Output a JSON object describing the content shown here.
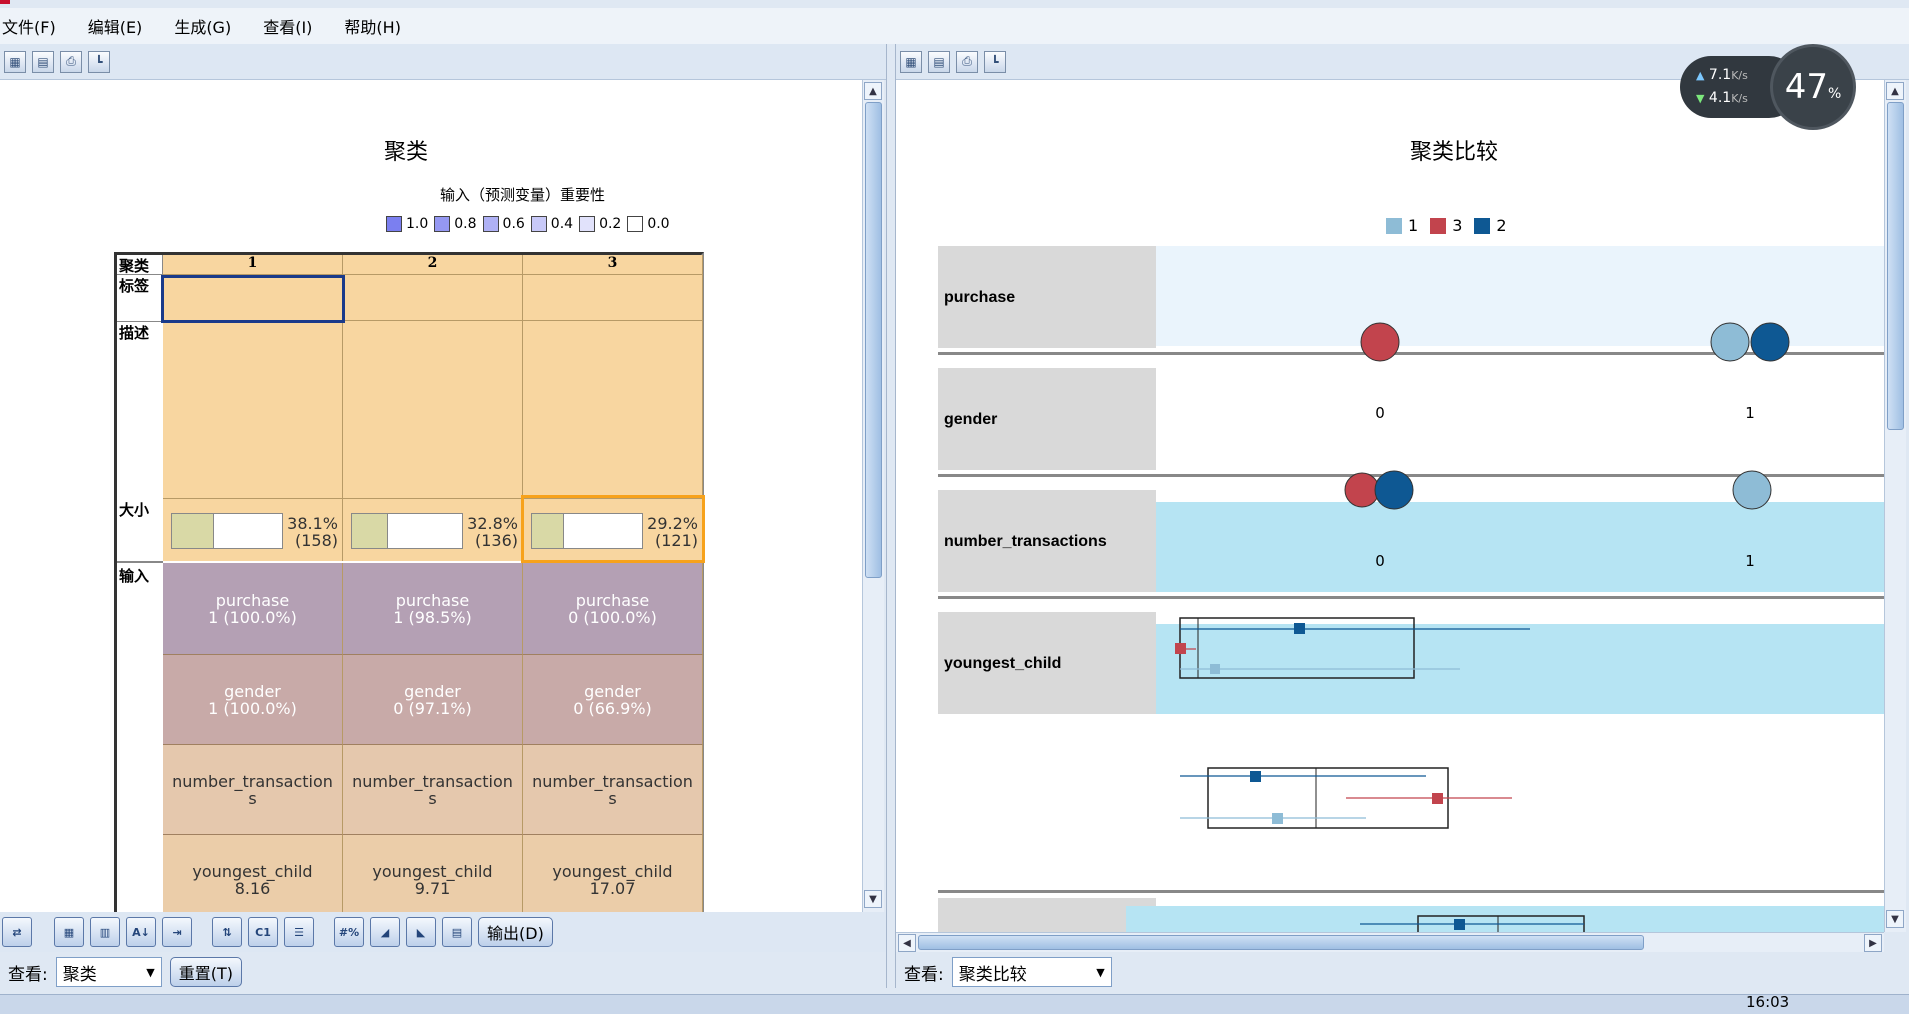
{
  "menu": [
    "文件(F)",
    "编辑(E)",
    "生成(G)",
    "查看(I)",
    "帮助(H)"
  ],
  "left": {
    "title": "聚类",
    "legend_title": "输入（预测变量）重要性",
    "legend": [
      {
        "label": "1.0",
        "color": "#7b7ff0"
      },
      {
        "label": "0.8",
        "color": "#9598f2"
      },
      {
        "label": "0.6",
        "color": "#afb1f5"
      },
      {
        "label": "0.4",
        "color": "#c8c9f8"
      },
      {
        "label": "0.2",
        "color": "#e1e2fb"
      },
      {
        "label": "0.0",
        "color": "#ffffff"
      }
    ],
    "row_labels": {
      "cluster": "聚类",
      "tag": "标签",
      "desc": "描述",
      "size": "大小",
      "input": "输入"
    },
    "clusters": [
      {
        "id": "1",
        "pct": "38.1%",
        "n": "(158)",
        "fill": 0.381,
        "purchase": [
          "purchase",
          "1 (100.0%)"
        ],
        "gender": [
          "gender",
          "1 (100.0%)"
        ],
        "nt": [
          "number_transaction",
          "s"
        ],
        "yc": [
          "youngest_child",
          "8.16"
        ]
      },
      {
        "id": "2",
        "pct": "32.8%",
        "n": "(136)",
        "fill": 0.328,
        "purchase": [
          "purchase",
          "1 (98.5%)"
        ],
        "gender": [
          "gender",
          "0 (97.1%)"
        ],
        "nt": [
          "number_transaction",
          "s"
        ],
        "yc": [
          "youngest_child",
          "9.71"
        ]
      },
      {
        "id": "3",
        "pct": "29.2%",
        "n": "(121)",
        "fill": 0.292,
        "purchase": [
          "purchase",
          "0 (100.0%)"
        ],
        "gender": [
          "gender",
          "0 (66.9%)"
        ],
        "nt": [
          "number_transaction",
          "s"
        ],
        "yc": [
          "youngest_child",
          "17.07"
        ]
      }
    ],
    "colors": {
      "header": "#f8d6a0",
      "purchase": "#b4a0b4",
      "gender": "#c8aaa8",
      "nt": "#e5c8ad",
      "yc": "#ebcda9",
      "highlight": "#f7a21b",
      "select": "#1a3a8a"
    }
  },
  "right": {
    "title": "聚类比较",
    "legend": [
      {
        "label": "1",
        "color": "#8ebcd6"
      },
      {
        "label": "3",
        "color": "#c2444d"
      },
      {
        "label": "2",
        "color": "#0e5893"
      }
    ],
    "variables": [
      "purchase",
      "gender",
      "number_transactions",
      "youngest_child"
    ],
    "purchase_ticks": [
      "0",
      "1"
    ],
    "gender_ticks": [
      "0",
      "1"
    ]
  },
  "bottom_left": {
    "output_button": "输出(D)",
    "view_label": "查看:",
    "view_value": "聚类",
    "reset_button": "重置(T)"
  },
  "bottom_right": {
    "view_label": "查看:",
    "view_value": "聚类比较"
  },
  "net": {
    "up": "7.1",
    "down": "4.1",
    "unit": "K/s",
    "percent": "47",
    "pct_sign": "%"
  },
  "clock": "16:03"
}
